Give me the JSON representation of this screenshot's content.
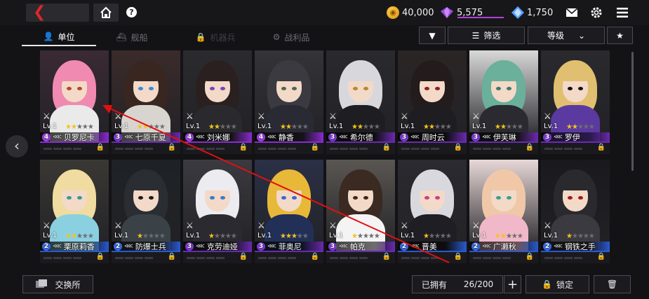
{
  "header": {
    "back_glyph": "❮",
    "help_glyph": "?",
    "resources": [
      {
        "name": "gold-coin",
        "value": "40,000",
        "color": "#f0a820"
      },
      {
        "name": "purple-gem",
        "value": "5,575",
        "color": "#9b4de0"
      },
      {
        "name": "blue-crystal",
        "value": "1,750",
        "color": "#5aa0ff"
      }
    ]
  },
  "tabs": [
    {
      "label": "单位",
      "icon": "person-icon",
      "state": "active"
    },
    {
      "label": "舰船",
      "icon": "ship-icon",
      "state": "dim"
    },
    {
      "label": "机器兵",
      "icon": "lock-icon",
      "state": "dimmer"
    },
    {
      "label": "战利品",
      "icon": "loot-icon",
      "state": "dim"
    }
  ],
  "filters": {
    "sort_dir_glyph": "▼",
    "filter_label": "筛选",
    "sort_label": "等级",
    "sort_caret": "⌄",
    "fav_glyph": "★"
  },
  "units": [
    {
      "name": "贝罗尼卡",
      "level": "Lv.1",
      "rank": "4",
      "stars": 2,
      "max_stars": 5,
      "rank_color": "#a040e0",
      "bar": "#8a2bd0",
      "hair": "#f08ab0",
      "bg": "#3a2a34",
      "outfit": "#eaeaea",
      "eye": "#b04a2a"
    },
    {
      "name": "七原千夏",
      "level": "Lv.1",
      "rank": "3",
      "stars": 2,
      "max_stars": 5,
      "rank_color": "#7a3ad0",
      "bar": "#6a2ab0",
      "hair": "#3a2620",
      "bg": "#3b2b2b",
      "outfit": "#d8d4d0",
      "eye": "#3a8ad0"
    },
    {
      "name": "刘米娜",
      "level": "Lv.1",
      "rank": "4",
      "stars": 2,
      "max_stars": 5,
      "rank_color": "#a040e0",
      "bar": "#8a2bd0",
      "hair": "#2a2020",
      "bg": "#2b2b2e",
      "outfit": "#2a2a2e",
      "eye": "#7a40c0"
    },
    {
      "name": "静香",
      "level": "Lv.1",
      "rank": "4",
      "stars": 2,
      "max_stars": 5,
      "rank_color": "#a040e0",
      "bar": "#8a2bd0",
      "hair": "#3a3a40",
      "bg": "#343438",
      "outfit": "#2a2a34",
      "eye": "#4a6a4a"
    },
    {
      "name": "希尔德",
      "level": "Lv.1",
      "rank": "3",
      "stars": 2,
      "max_stars": 5,
      "rank_color": "#7a3ad0",
      "bar": "#6a2ab0",
      "hair": "#d8d8dc",
      "bg": "#2a2a2e",
      "outfit": "#1e1e22",
      "eye": "#b08a30"
    },
    {
      "name": "周时云",
      "level": "Lv.1",
      "rank": "3",
      "stars": 2,
      "max_stars": 5,
      "rank_color": "#7a3ad0",
      "bar": "#6a2ab0",
      "hair": "#241c1c",
      "bg": "#2b2525",
      "outfit": "#1e1e22",
      "eye": "#8a2020"
    },
    {
      "name": "伊芙琳",
      "level": "Lv.1",
      "rank": "3",
      "stars": 2,
      "max_stars": 5,
      "rank_color": "#7a3ad0",
      "bar": "#6a2ab0",
      "hair": "#6ab09a",
      "bg": "#d8d8d8",
      "outfit": "#2a2a30",
      "eye": "#3a7a6a"
    },
    {
      "name": "罗伊",
      "level": "Lv.1",
      "rank": "3",
      "stars": 2,
      "max_stars": 5,
      "rank_color": "#7a3ad0",
      "bar": "#6a2ab0",
      "hair": "#e0c070",
      "bg": "#2a2a2e",
      "outfit": "#5a3aa0",
      "eye": "#111111"
    },
    {
      "name": "栗原莉香",
      "level": "Lv.1",
      "rank": "2",
      "stars": 2,
      "max_stars": 5,
      "rank_color": "#3a6ae0",
      "bar": "#2a5ad0",
      "hair": "#f0dca0",
      "bg": "#3a3834",
      "outfit": "#8ad0e0",
      "eye": "#3a9a8a"
    },
    {
      "name": "防爆士兵",
      "level": "Lv.1",
      "rank": "2",
      "stars": 1,
      "max_stars": 5,
      "rank_color": "#3a6ae0",
      "bar": "#2a5ad0",
      "hair": "#2a2e32",
      "bg": "#1e2226",
      "outfit": "#3a4248",
      "eye": "#1a1a1a"
    },
    {
      "name": "克劳迪娅",
      "level": "Lv.1",
      "rank": "3",
      "stars": 1,
      "max_stars": 5,
      "rank_color": "#7a3ad0",
      "bar": "#6a2ab0",
      "hair": "#ececf0",
      "bg": "#3a3a40",
      "outfit": "#2a2a30",
      "eye": "#3a7ad0"
    },
    {
      "name": "菲奥尼",
      "level": "Lv.1",
      "rank": "3",
      "stars": 3,
      "max_stars": 5,
      "rank_color": "#7a3ad0",
      "bar": "#6a2ab0",
      "hair": "#e8b838",
      "bg": "#2a3046",
      "outfit": "#223058",
      "eye": "#3a6ad0"
    },
    {
      "name": "帕克",
      "level": "Lv.1",
      "rank": "3",
      "stars": 1,
      "max_stars": 5,
      "rank_color": "#7a3ad0",
      "bar": "#6a2ab0",
      "hair": "#3a2a22",
      "bg": "#5a5652",
      "outfit": "#f4f4f4",
      "eye": "#3a2a1a"
    },
    {
      "name": "晋美",
      "level": "Lv.1",
      "rank": "2",
      "stars": 1,
      "max_stars": 5,
      "rank_color": "#3a6ae0",
      "bar": "#2a5ad0",
      "hair": "#d8d8de",
      "bg": "#2a2a30",
      "outfit": "#1e1e24",
      "eye": "#d03a8a"
    },
    {
      "name": "广濑秋",
      "level": "Lv.1",
      "rank": "2",
      "stars": 2,
      "max_stars": 5,
      "rank_color": "#3a6ae0",
      "bar": "#2a5ad0",
      "hair": "#f0c8a8",
      "bg": "#e8d8d8",
      "outfit": "#f0b8c8",
      "eye": "#3aa08a"
    },
    {
      "name": "钢铁之手",
      "level": "Lv.1",
      "rank": "2",
      "stars": 1,
      "max_stars": 5,
      "rank_color": "#3a6ae0",
      "bar": "#2a5ad0",
      "hair": "#2a2a2e",
      "bg": "#1a1a1e",
      "outfit": "#3a3a40",
      "eye": "#a01a1a"
    }
  ],
  "footer": {
    "exchange_label": "交换所",
    "owned_label": "已拥有",
    "owned_count": "26/200",
    "add_glyph": "+",
    "lock_label": "锁定",
    "trash_glyph": "🗑"
  },
  "annotation_color": "#e01010"
}
